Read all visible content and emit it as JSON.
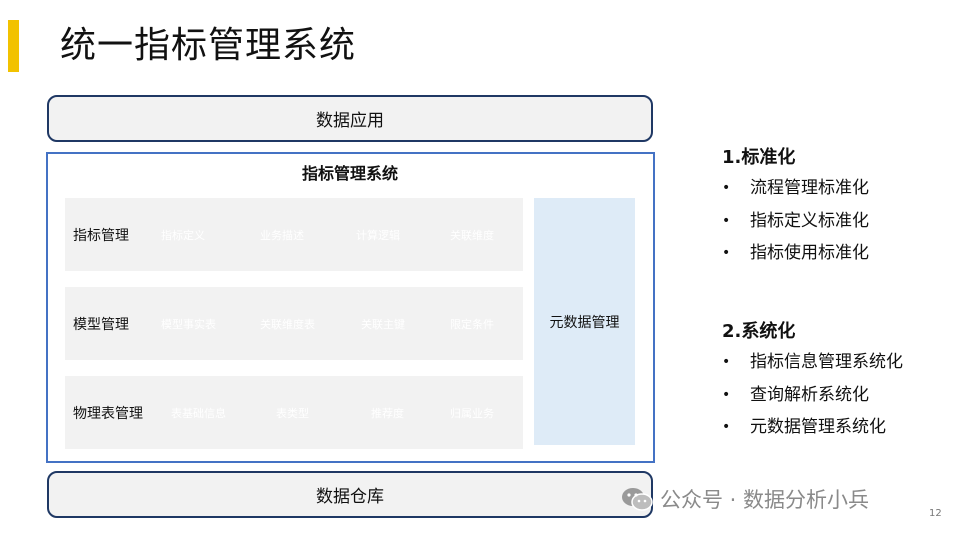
{
  "slide": {
    "title": "统一指标管理系统",
    "page_number": "12"
  },
  "diagram": {
    "top_layer": "数据应用",
    "bottom_layer": "数据仓库",
    "system_title": "指标管理系统",
    "rows": [
      {
        "label": "指标管理",
        "items": [
          "指标定义",
          "业务描述",
          "计算逻辑",
          "关联维度"
        ]
      },
      {
        "label": "模型管理",
        "items": [
          "模型事实表",
          "关联维度表",
          "关联主键",
          "限定条件"
        ]
      },
      {
        "label": "物理表管理",
        "items": [
          "表基础信息",
          "表类型",
          "推荐度",
          "归属业务"
        ]
      }
    ],
    "metadata_box": "元数据管理"
  },
  "sidebar": {
    "sections": [
      {
        "heading": "1.标准化",
        "bullets": [
          "流程管理标准化",
          "指标定义标准化",
          "指标使用标准化"
        ]
      },
      {
        "heading": "2.系统化",
        "bullets": [
          "指标信息管理系统化",
          "查询解析系统化",
          "元数据管理系统化"
        ]
      }
    ],
    "bullet_glyph": "•"
  },
  "watermark": {
    "icon": "wechat-icon",
    "text": "公众号 · 数据分析小兵"
  },
  "colors": {
    "accent": "#f2c200",
    "frame": "#1f3864",
    "system_border": "#4472c4",
    "row_fill": "#f2f2f2",
    "metadata_fill": "#deebf7"
  }
}
